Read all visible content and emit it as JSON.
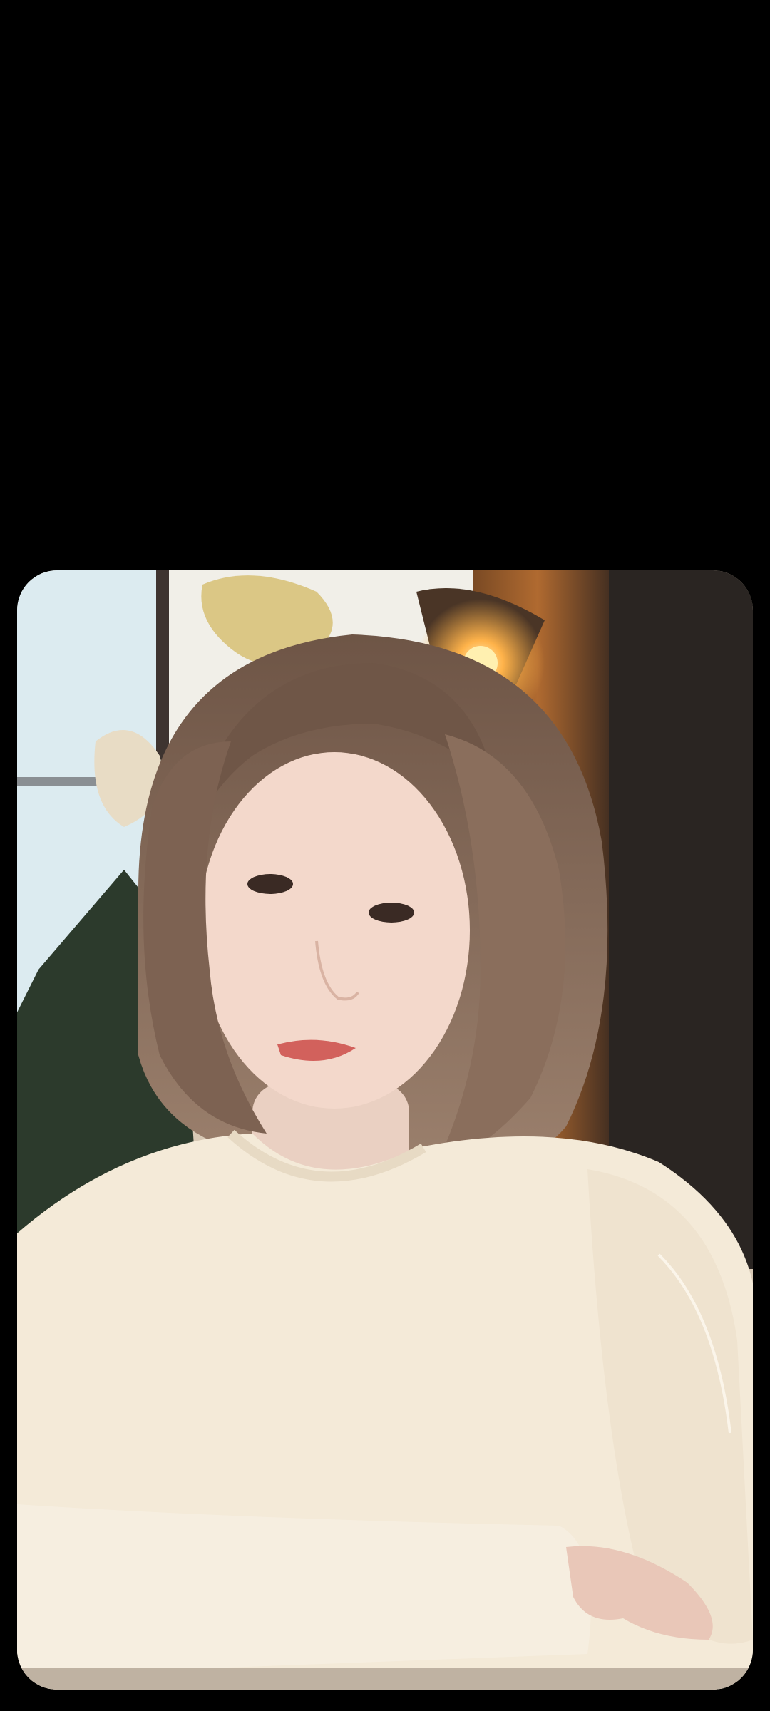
{
  "screen": {
    "background_color": "#000000"
  },
  "photo": {
    "subject_icon": "person-portrait-icon",
    "palette": {
      "window_light": "#dcebf0",
      "wall_wood": "#3a2a20",
      "lamp_glow": "#ffb34a",
      "hair": "#7a6252",
      "skin": "#f3d8cb",
      "sweater": "#f4ead8",
      "tree": "#2c3a2c"
    }
  }
}
